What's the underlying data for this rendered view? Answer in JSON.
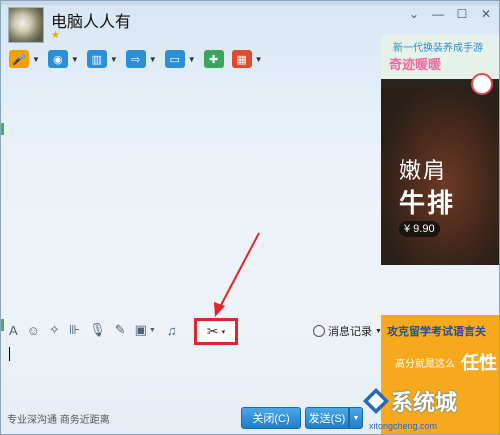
{
  "window": {
    "title": "电脑人人有",
    "star": "★",
    "controls": [
      "⌄",
      "—",
      "☐",
      "✕"
    ]
  },
  "toolbar": {
    "items": [
      {
        "name": "voice",
        "icon": "microphone-icon",
        "color": "#f2a000",
        "glyph": "🎤"
      },
      {
        "name": "video",
        "icon": "camera-icon",
        "color": "#2a8fd6",
        "glyph": "◉"
      },
      {
        "name": "remote",
        "icon": "monitor-chart-icon",
        "color": "#2a8fd6",
        "glyph": "▥"
      },
      {
        "name": "file",
        "icon": "folder-icon",
        "color": "#2a8fd6",
        "glyph": "⇨"
      },
      {
        "name": "screen",
        "icon": "screen-share-icon",
        "color": "#2a8fd6",
        "glyph": "▭"
      },
      {
        "name": "message",
        "icon": "message-add-icon",
        "color": "#3aa55c",
        "glyph": "✚"
      },
      {
        "name": "apps",
        "icon": "app-grid-icon",
        "color": "#e04a2f",
        "glyph": "▦"
      }
    ]
  },
  "ad_top": {
    "line1": "新一代换装养成手游",
    "line2": "奇迹暖暖",
    "product1": "嫩肩",
    "product2": "牛排",
    "price": "¥ 9.90"
  },
  "editor_toolbar": {
    "items": [
      {
        "name": "font",
        "icon": "font-icon",
        "glyph": "A"
      },
      {
        "name": "emoji",
        "icon": "smiley-icon",
        "glyph": "☺"
      },
      {
        "name": "poke",
        "icon": "magic-wand-icon",
        "glyph": "✧"
      },
      {
        "name": "shake",
        "icon": "window-shake-icon",
        "glyph": "⊪"
      },
      {
        "name": "voice-msg",
        "icon": "microphone-icon",
        "glyph": "🎙"
      },
      {
        "name": "doodle",
        "icon": "edit-icon",
        "glyph": "✎"
      },
      {
        "name": "image",
        "icon": "image-icon",
        "glyph": "▣"
      },
      {
        "name": "music",
        "icon": "music-note-icon",
        "glyph": "♫"
      }
    ],
    "screenshot_glyph": "✂",
    "dropdown_glyph": "▾",
    "message_record": "消息记录"
  },
  "footer": {
    "slogan": "专业深沟通 商务近距离",
    "close_label": "关闭(C)",
    "send_label": "发送(S)"
  },
  "ad_bottom": {
    "line1": "攻克留学考试语言关",
    "line2": "高分就是这么",
    "line3": "任性"
  },
  "watermark": {
    "text": "系统城",
    "url": "xitongcheng.com"
  },
  "colors": {
    "highlight": "#e0262b",
    "button": "#1f7ec9"
  }
}
